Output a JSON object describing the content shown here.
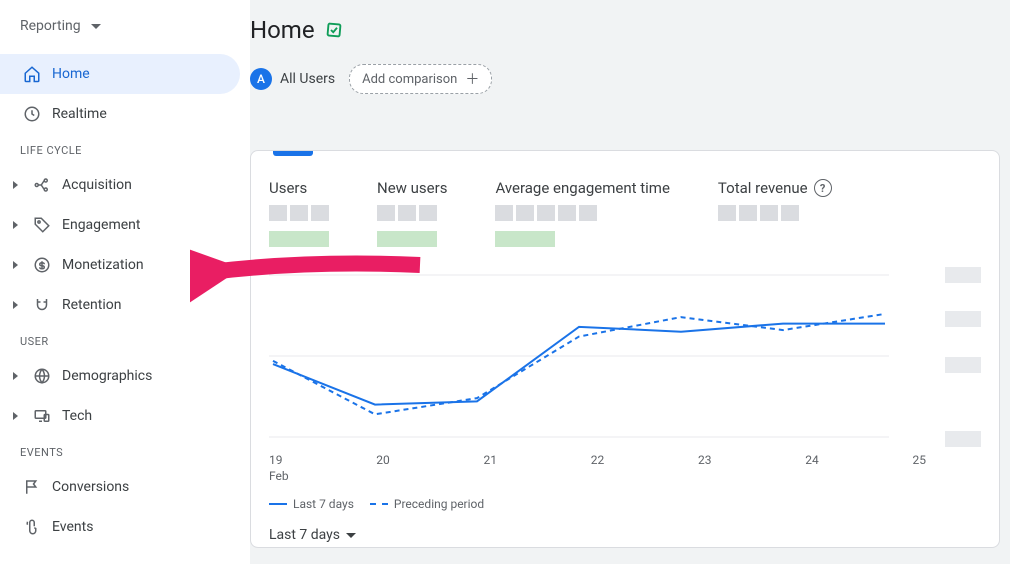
{
  "sidebar": {
    "reporting_label": "Reporting",
    "items": [
      {
        "label": "Home"
      },
      {
        "label": "Realtime"
      }
    ],
    "sections": [
      {
        "label": "LIFE CYCLE",
        "items": [
          {
            "label": "Acquisition"
          },
          {
            "label": "Engagement"
          },
          {
            "label": "Monetization"
          },
          {
            "label": "Retention"
          }
        ]
      },
      {
        "label": "USER",
        "items": [
          {
            "label": "Demographics"
          },
          {
            "label": "Tech"
          }
        ]
      },
      {
        "label": "EVENTS",
        "items": [
          {
            "label": "Conversions"
          },
          {
            "label": "Events"
          }
        ]
      }
    ]
  },
  "header": {
    "title": "Home",
    "all_users": "All Users",
    "all_users_letter": "A",
    "add_comparison": "Add comparison"
  },
  "metrics": [
    {
      "label": "Users"
    },
    {
      "label": "New users"
    },
    {
      "label": "Average engagement time"
    },
    {
      "label": "Total revenue",
      "help": true
    }
  ],
  "legend": {
    "current": "Last 7 days",
    "previous": "Preceding period"
  },
  "date_selector": "Last 7 days",
  "chart_data": {
    "type": "line",
    "title": "",
    "xlabel": "Feb",
    "ylabel": "",
    "x": [
      "19",
      "20",
      "21",
      "22",
      "23",
      "24",
      "25"
    ],
    "series": [
      {
        "name": "Last 7 days",
        "style": "solid",
        "values": [
          45,
          20,
          22,
          68,
          65,
          70,
          70
        ]
      },
      {
        "name": "Preceding period",
        "style": "dashed",
        "values": [
          47,
          14,
          24,
          62,
          74,
          66,
          76
        ]
      }
    ],
    "ylim": [
      0,
      100
    ],
    "gridlines": [
      0,
      50,
      100
    ],
    "month_sub": "Feb"
  },
  "colors": {
    "accent": "#1a73e8",
    "arrow": "#e91e63"
  }
}
